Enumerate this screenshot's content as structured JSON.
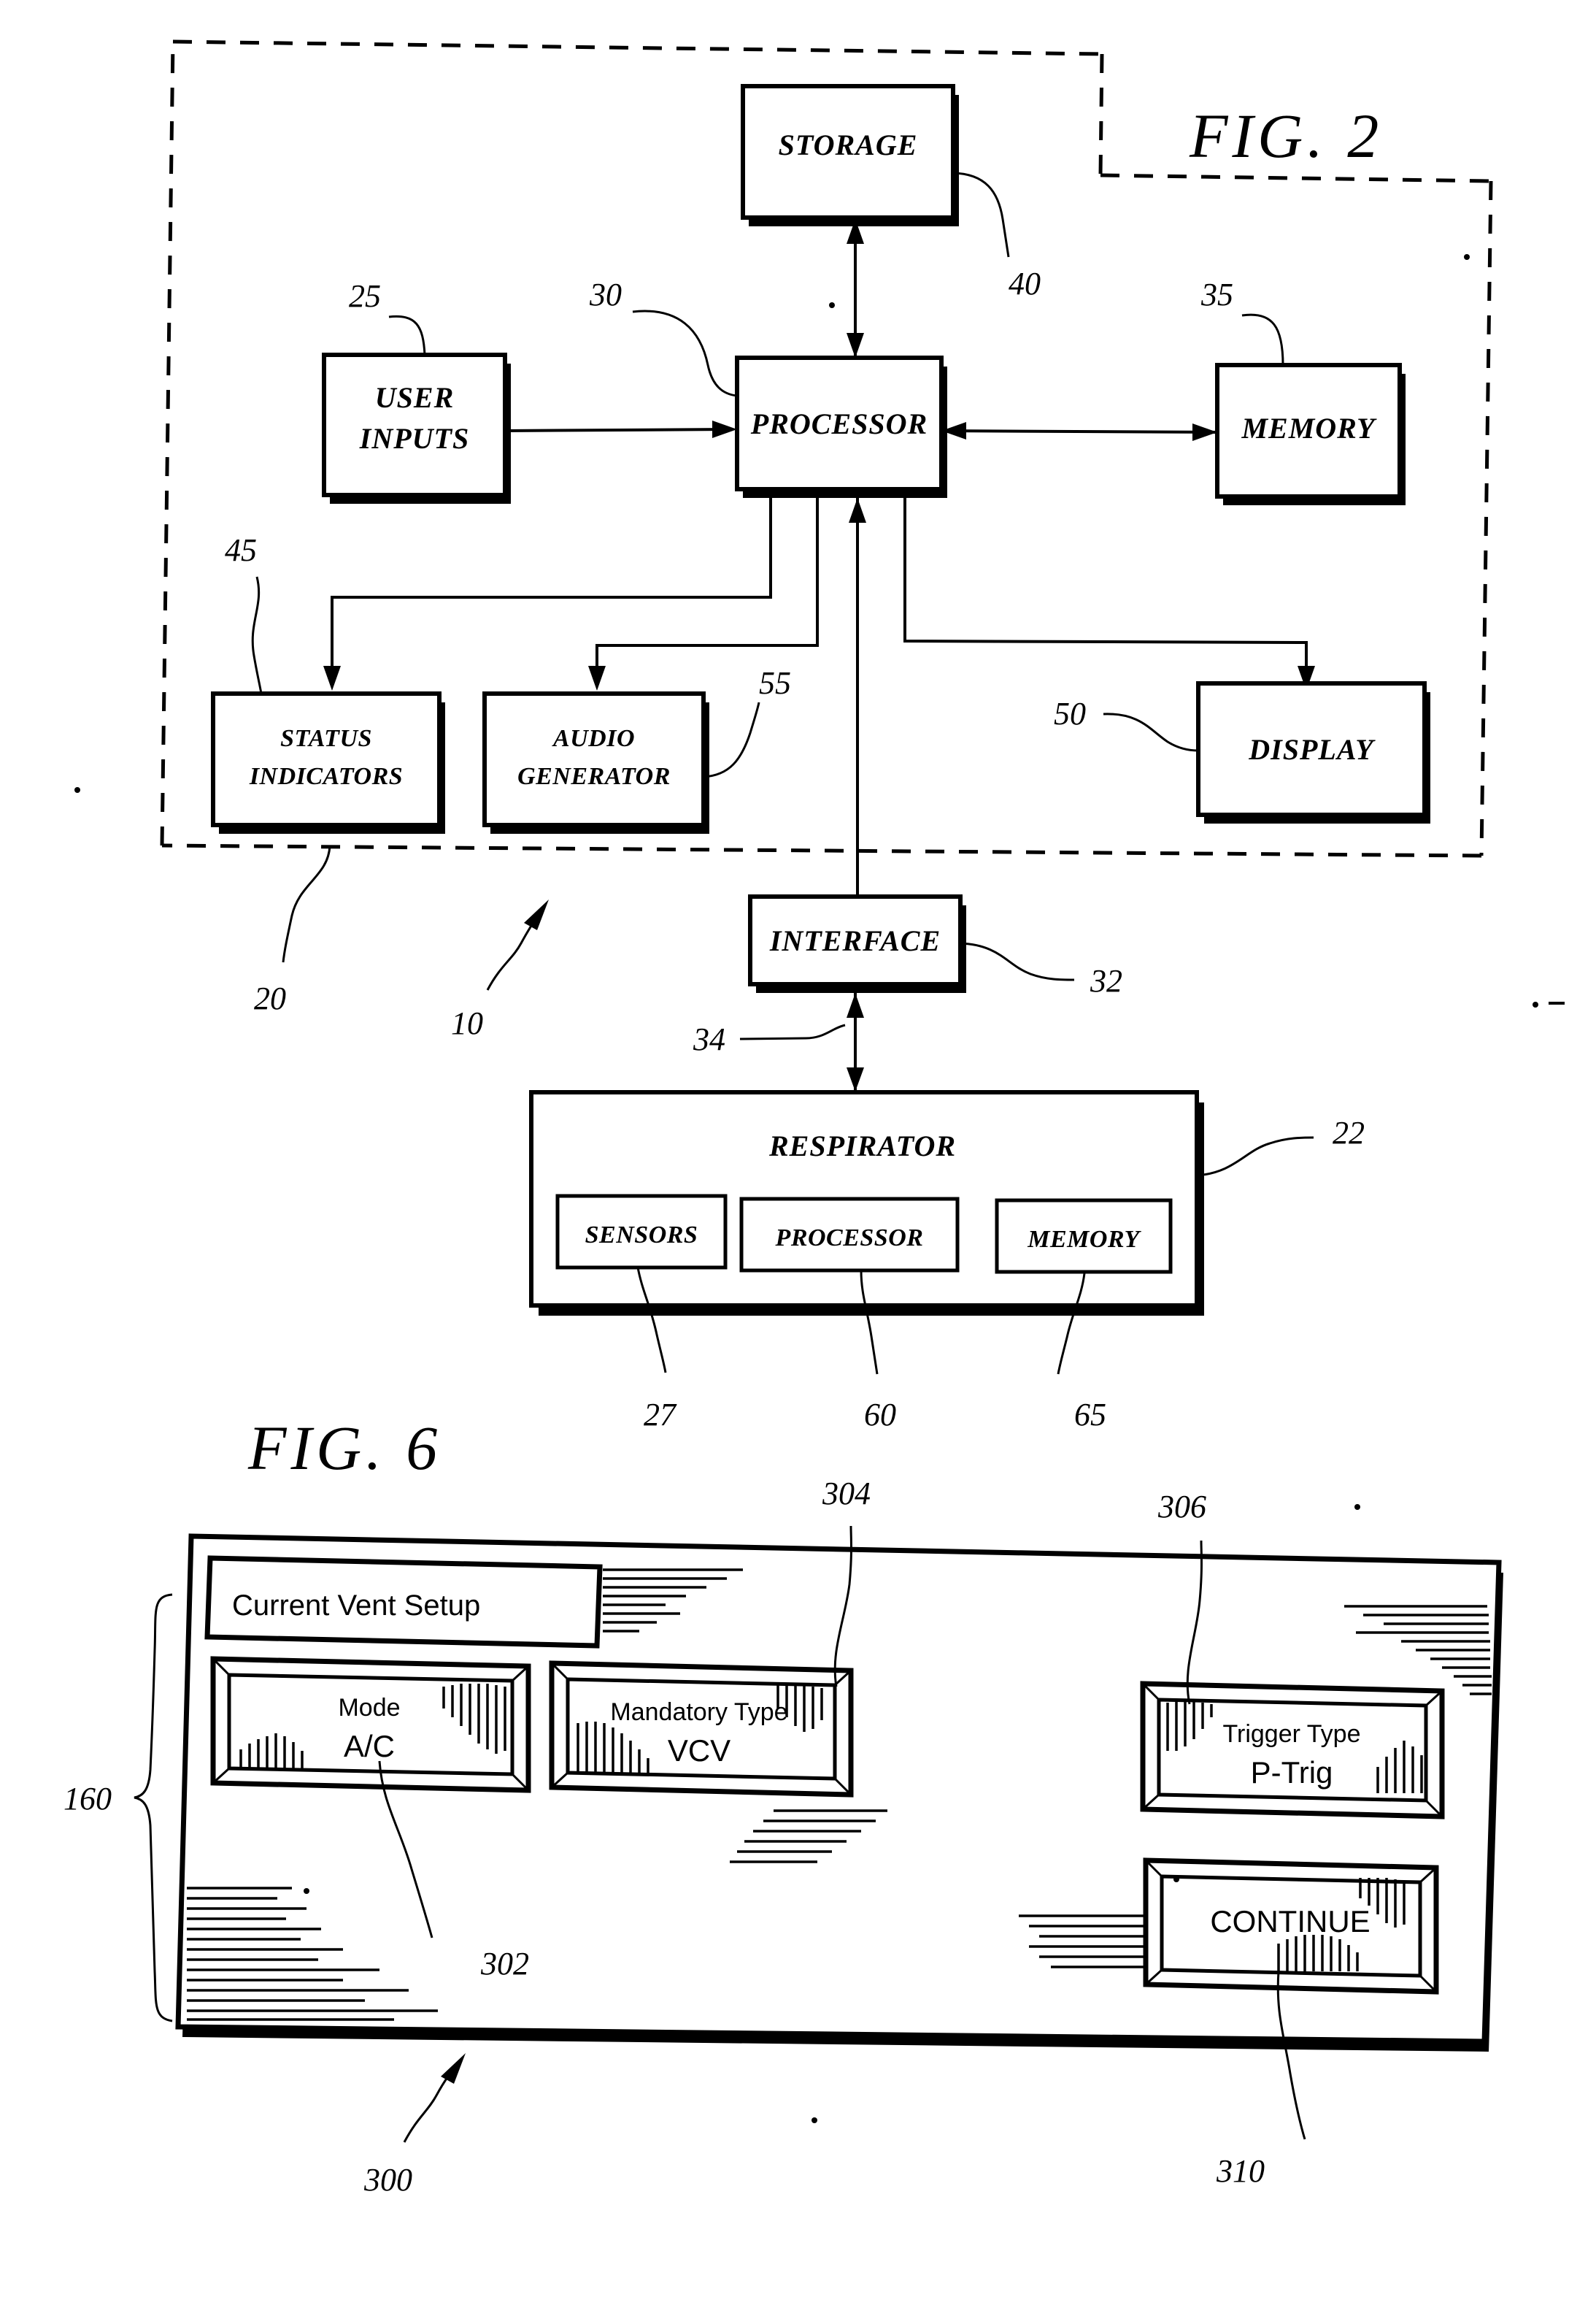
{
  "figures": [
    {
      "id": "fig2",
      "label": "FIG.  2",
      "system_ref": "10",
      "boxes": [
        {
          "key": "storage",
          "label": "STORAGE",
          "ref": "40"
        },
        {
          "key": "user_inputs",
          "label": "USER\nINPUTS",
          "ref": "25"
        },
        {
          "key": "processor",
          "label": "PROCESSOR",
          "ref": "30"
        },
        {
          "key": "memory",
          "label": "MEMORY",
          "ref": "35"
        },
        {
          "key": "status_indicators",
          "label": "STATUS\nINDICATORS",
          "ref": "45"
        },
        {
          "key": "audio_generator",
          "label": "AUDIO\nGENERATOR",
          "ref": "55"
        },
        {
          "key": "display",
          "label": "DISPLAY",
          "ref": "50"
        },
        {
          "key": "interface",
          "label": "INTERFACE",
          "ref": "32"
        },
        {
          "key": "respirator",
          "label": "RESPIRATOR",
          "ref": "22"
        },
        {
          "key": "resp_sensors",
          "label": "SENSORS",
          "ref": "27"
        },
        {
          "key": "resp_processor",
          "label": "PROCESSOR",
          "ref": "60"
        },
        {
          "key": "resp_memory",
          "label": "MEMORY",
          "ref": "65"
        }
      ],
      "enclosure_ref": "20",
      "link_ref": "34"
    },
    {
      "id": "fig6",
      "label": "FIG.  6",
      "screen_ref": "300",
      "group_ref": "160",
      "title": "Current Vent Setup",
      "buttons": [
        {
          "key": "mode",
          "caption": "Mode",
          "value": "A/C",
          "ref": "302"
        },
        {
          "key": "mandatory",
          "caption": "Mandatory Type",
          "value": "VCV",
          "ref": "304"
        },
        {
          "key": "trigger",
          "caption": "Trigger Type",
          "value": "P-Trig",
          "ref": "306"
        },
        {
          "key": "continue",
          "caption": "CONTINUE",
          "value": "",
          "ref": "310"
        }
      ]
    }
  ],
  "labels": {
    "fig2_title": "FIG.  2",
    "fig6_title": "FIG.  6",
    "storage": "STORAGE",
    "user_inputs_l1": "USER",
    "user_inputs_l2": "INPUTS",
    "processor": "PROCESSOR",
    "memory": "MEMORY",
    "status_l1": "STATUS",
    "status_l2": "INDICATORS",
    "audio_l1": "AUDIO",
    "audio_l2": "GENERATOR",
    "display": "DISPLAY",
    "interface": "INTERFACE",
    "respirator": "RESPIRATOR",
    "sensors": "SENSORS",
    "resp_processor": "PROCESSOR",
    "resp_memory": "MEMORY",
    "vent_setup_title": "Current Vent Setup",
    "mode_caption": "Mode",
    "mode_value": "A/C",
    "mandatory_caption": "Mandatory Type",
    "mandatory_value": "VCV",
    "trigger_caption": "Trigger Type",
    "trigger_value": "P-Trig",
    "continue_label": "CONTINUE"
  },
  "refs": {
    "n10": "10",
    "n20": "20",
    "n22": "22",
    "n25": "25",
    "n27": "27",
    "n30": "30",
    "n32": "32",
    "n34": "34",
    "n35": "35",
    "n40": "40",
    "n45": "45",
    "n50": "50",
    "n55": "55",
    "n60": "60",
    "n65": "65",
    "n160": "160",
    "n300": "300",
    "n302": "302",
    "n304": "304",
    "n306": "306",
    "n310": "310"
  },
  "colors": {
    "ink": "#000000",
    "paper": "#ffffff"
  }
}
